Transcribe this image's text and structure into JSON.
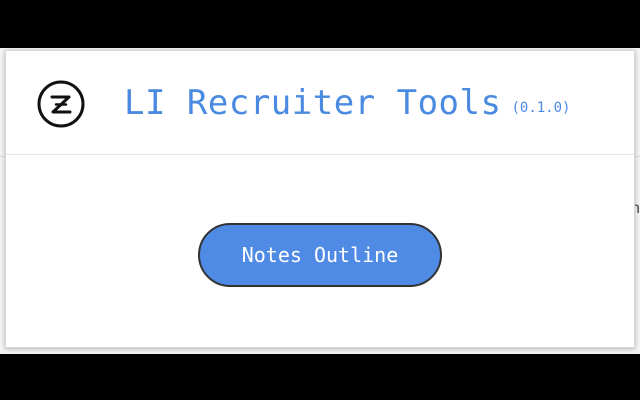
{
  "header": {
    "logo_icon": "z-circle-logo-icon",
    "title": "LI Recruiter Tools",
    "version": "(0.1.0)"
  },
  "main": {
    "notes_button_label": "Notes Outline"
  },
  "background": {
    "glyph": "n"
  },
  "colors": {
    "accent": "#4a8ae0",
    "button": "#4f8ae4",
    "button_border": "#333333",
    "frame": "#000000"
  }
}
